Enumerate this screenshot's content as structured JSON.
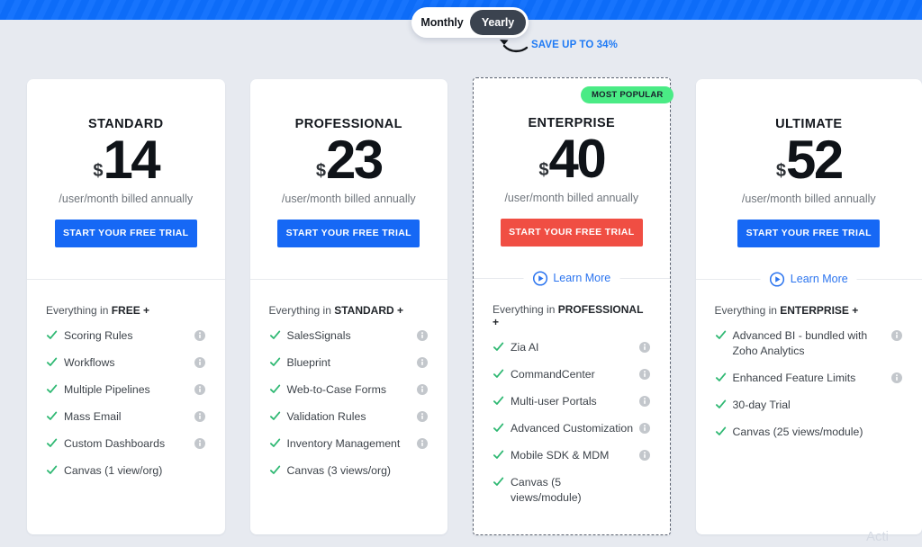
{
  "theme": {
    "band_color": "#0d6efd",
    "page_bg": "#e7eaf0",
    "primary_button": "#1668f5",
    "featured_button": "#f04e43",
    "badge_green": "#4aeb85",
    "check_green": "#2eb872",
    "link_blue": "#2b74ef"
  },
  "billing_toggle": {
    "monthly_label": "Monthly",
    "yearly_label": "Yearly",
    "selected": "Yearly"
  },
  "save_note": "SAVE UP TO 34%",
  "watermark": "Acti",
  "plans": [
    {
      "name": "STANDARD",
      "currency": "$",
      "amount": "14",
      "billing_note": "/user/month billed annually",
      "cta_label": "START YOUR FREE TRIAL",
      "cta_style": "blue",
      "badge": null,
      "learn_more": null,
      "features_head_prefix": "Everything in ",
      "features_head_bold": "FREE +",
      "features": [
        {
          "label": "Scoring Rules",
          "info": true
        },
        {
          "label": "Workflows",
          "info": true
        },
        {
          "label": "Multiple Pipelines",
          "info": true
        },
        {
          "label": "Mass Email",
          "info": true
        },
        {
          "label": "Custom Dashboards",
          "info": true
        },
        {
          "label": "Canvas (1 view/org)",
          "info": false
        }
      ]
    },
    {
      "name": "PROFESSIONAL",
      "currency": "$",
      "amount": "23",
      "billing_note": "/user/month billed annually",
      "cta_label": "START YOUR FREE TRIAL",
      "cta_style": "blue",
      "badge": null,
      "learn_more": null,
      "features_head_prefix": "Everything in ",
      "features_head_bold": "STANDARD +",
      "features": [
        {
          "label": "SalesSignals",
          "info": true
        },
        {
          "label": "Blueprint",
          "info": true
        },
        {
          "label": "Web-to-Case Forms",
          "info": true
        },
        {
          "label": "Validation Rules",
          "info": true
        },
        {
          "label": "Inventory Management",
          "info": true
        },
        {
          "label": "Canvas (3 views/org)",
          "info": false
        }
      ]
    },
    {
      "name": "ENTERPRISE",
      "currency": "$",
      "amount": "40",
      "billing_note": "/user/month billed annually",
      "cta_label": "START YOUR FREE TRIAL",
      "cta_style": "red",
      "badge": "MOST POPULAR",
      "learn_more": "Learn More",
      "features_head_prefix": "Everything in ",
      "features_head_bold": "PROFESSIONAL +",
      "features": [
        {
          "label": "Zia AI",
          "info": true
        },
        {
          "label": "CommandCenter",
          "info": true
        },
        {
          "label": "Multi-user Portals",
          "info": true
        },
        {
          "label": "Advanced Customization",
          "info": true
        },
        {
          "label": "Mobile SDK & MDM",
          "info": true
        },
        {
          "label": "Canvas (5 views/module)",
          "info": false
        }
      ]
    },
    {
      "name": "ULTIMATE",
      "currency": "$",
      "amount": "52",
      "billing_note": "/user/month billed annually",
      "cta_label": "START YOUR FREE TRIAL",
      "cta_style": "blue",
      "badge": null,
      "learn_more": "Learn More",
      "features_head_prefix": "Everything in ",
      "features_head_bold": "ENTERPRISE +",
      "features": [
        {
          "label": "Advanced BI - bundled with Zoho Analytics",
          "info": true
        },
        {
          "label": "Enhanced Feature Limits",
          "info": true
        },
        {
          "label": "30-day Trial",
          "info": false
        },
        {
          "label": "Canvas (25 views/module)",
          "info": false
        }
      ]
    }
  ]
}
